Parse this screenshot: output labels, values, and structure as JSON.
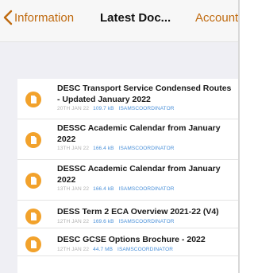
{
  "nav": {
    "back_label": "Information",
    "title": "Latest Doc...",
    "right_label": "Account"
  },
  "colors": {
    "accent": "#bf6a0f",
    "icon_fill": "#f2a22c",
    "meta_blue": "#4a90d9"
  },
  "documents": [
    {
      "title": "DESC Transport Service Condensed Routes - Updated January 2022",
      "date": "20TH JAN 22",
      "size": "109.7 kB",
      "author": "ISAMSCOORDINATOR",
      "icon": "document-icon"
    },
    {
      "title": "DESSC Academic Calendar from January 2022",
      "date": "13TH JAN 22",
      "size": "166.4 kB",
      "author": "ISAMSCOORDINATOR",
      "icon": "document-icon"
    },
    {
      "title": "DESSC Academic Calendar from January 2022",
      "date": "13TH JAN 22",
      "size": "166.4 kB",
      "author": "ISAMSCOORDINATOR",
      "icon": "document-icon"
    },
    {
      "title": "DESS Term 2 ECA Overview 2021-22 (V4)",
      "date": "12TH JAN 22",
      "size": "169.6 kB",
      "author": "ISAMSCOORDINATOR",
      "icon": "document-icon"
    },
    {
      "title": "DESC GCSE Options Brochure - 2022",
      "date": "12TH JAN 22",
      "size": "44.7 MB",
      "author": "ISAMSCOORDINATOR",
      "icon": "document-icon"
    }
  ]
}
